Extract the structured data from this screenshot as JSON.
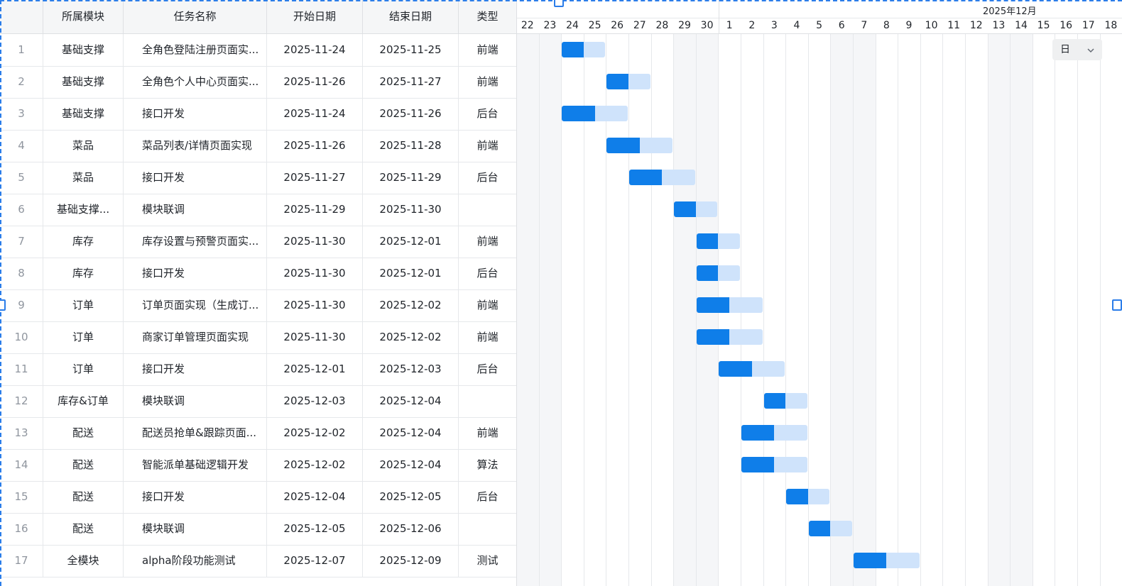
{
  "table": {
    "headers": {
      "index": "",
      "module": "所属模块",
      "name": "任务名称",
      "start": "开始日期",
      "end": "结束日期",
      "type": "类型"
    },
    "rows": [
      {
        "idx": "1",
        "module": "基础支撑",
        "name": "全角色登陆注册页面实...",
        "start": "2025-11-24",
        "end": "2025-11-25",
        "type": "前端"
      },
      {
        "idx": "2",
        "module": "基础支撑",
        "name": "全角色个人中心页面实...",
        "start": "2025-11-26",
        "end": "2025-11-27",
        "type": "前端"
      },
      {
        "idx": "3",
        "module": "基础支撑",
        "name": "接口开发",
        "start": "2025-11-24",
        "end": "2025-11-26",
        "type": "后台"
      },
      {
        "idx": "4",
        "module": "菜品",
        "name": "菜品列表/详情页面实现",
        "start": "2025-11-26",
        "end": "2025-11-28",
        "type": "前端"
      },
      {
        "idx": "5",
        "module": "菜品",
        "name": "接口开发",
        "start": "2025-11-27",
        "end": "2025-11-29",
        "type": "后台"
      },
      {
        "idx": "6",
        "module": "基础支撑...",
        "name": "模块联调",
        "start": "2025-11-29",
        "end": "2025-11-30",
        "type": ""
      },
      {
        "idx": "7",
        "module": "库存",
        "name": "库存设置与预警页面实...",
        "start": "2025-11-30",
        "end": "2025-12-01",
        "type": "前端"
      },
      {
        "idx": "8",
        "module": "库存",
        "name": "接口开发",
        "start": "2025-11-30",
        "end": "2025-12-01",
        "type": "后台"
      },
      {
        "idx": "9",
        "module": "订单",
        "name": "订单页面实现（生成订...",
        "start": "2025-11-30",
        "end": "2025-12-02",
        "type": "前端"
      },
      {
        "idx": "10",
        "module": "订单",
        "name": "商家订单管理页面实现",
        "start": "2025-11-30",
        "end": "2025-12-02",
        "type": "前端"
      },
      {
        "idx": "11",
        "module": "订单",
        "name": "接口开发",
        "start": "2025-12-01",
        "end": "2025-12-03",
        "type": "后台"
      },
      {
        "idx": "12",
        "module": "库存&订单",
        "name": "模块联调",
        "start": "2025-12-03",
        "end": "2025-12-04",
        "type": ""
      },
      {
        "idx": "13",
        "module": "配送",
        "name": "配送员抢单&跟踪页面...",
        "start": "2025-12-02",
        "end": "2025-12-04",
        "type": "前端"
      },
      {
        "idx": "14",
        "module": "配送",
        "name": "智能派单基础逻辑开发",
        "start": "2025-12-02",
        "end": "2025-12-04",
        "type": "算法"
      },
      {
        "idx": "15",
        "module": "配送",
        "name": "接口开发",
        "start": "2025-12-04",
        "end": "2025-12-05",
        "type": "后台"
      },
      {
        "idx": "16",
        "module": "配送",
        "name": "模块联调",
        "start": "2025-12-05",
        "end": "2025-12-06",
        "type": ""
      },
      {
        "idx": "17",
        "module": "全模块",
        "name": "alpha阶段功能测试",
        "start": "2025-12-07",
        "end": "2025-12-09",
        "type": "测试"
      }
    ]
  },
  "gantt": {
    "month_label": "2025年12月",
    "days": [
      "22",
      "23",
      "24",
      "25",
      "26",
      "27",
      "28",
      "29",
      "30",
      "1",
      "2",
      "3",
      "4",
      "5",
      "6",
      "7",
      "8",
      "9",
      "10",
      "11",
      "12",
      "13",
      "14",
      "15",
      "16",
      "17",
      "18"
    ],
    "weekend_days": [
      "22",
      "23",
      "29",
      "30",
      "6",
      "7",
      "13",
      "14"
    ],
    "scale_select": {
      "value": "日",
      "icon": "chevron-down-icon"
    },
    "progress": [
      0.5,
      0.5,
      0.5,
      0.5,
      0.5,
      0.5,
      0.5,
      0.5,
      0.5,
      0.5,
      0.5,
      0.5,
      0.5,
      0.5,
      0.5,
      0.5,
      0.5
    ],
    "colors": {
      "progress": "#0f7ee9",
      "bar": "#cfe3fb",
      "selection": "#2b7de9"
    }
  }
}
